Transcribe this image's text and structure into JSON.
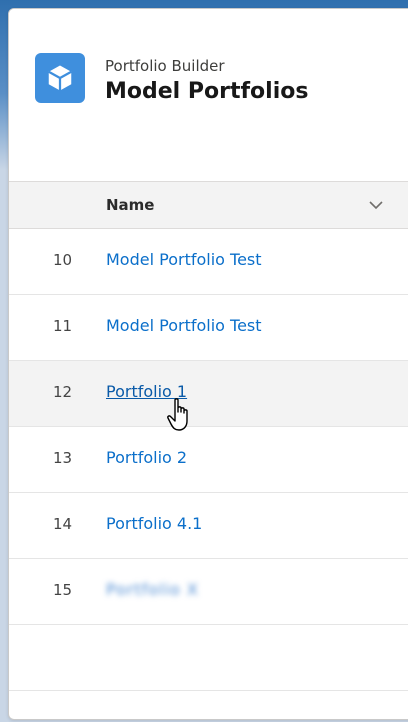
{
  "app": {
    "subtitle": "Portfolio Builder",
    "title": "Model Portfolios",
    "icon": "cube-icon",
    "accent_color": "#3f8fdd"
  },
  "table": {
    "columns": [
      {
        "label": "Name",
        "menu_icon": "chevron-down-icon"
      }
    ],
    "rows": [
      {
        "num": "10",
        "name": "Model Portfolio Test"
      },
      {
        "num": "11",
        "name": "Model Portfolio Test"
      },
      {
        "num": "12",
        "name": "Portfolio 1",
        "hovered": true
      },
      {
        "num": "13",
        "name": "Portfolio 2"
      },
      {
        "num": "14",
        "name": "Portfolio 4.1"
      },
      {
        "num": "15",
        "name": "Portfolio X",
        "redacted": true
      }
    ],
    "link_color": "#0b6fca"
  },
  "cursor": {
    "icon": "hand-pointer-icon"
  }
}
